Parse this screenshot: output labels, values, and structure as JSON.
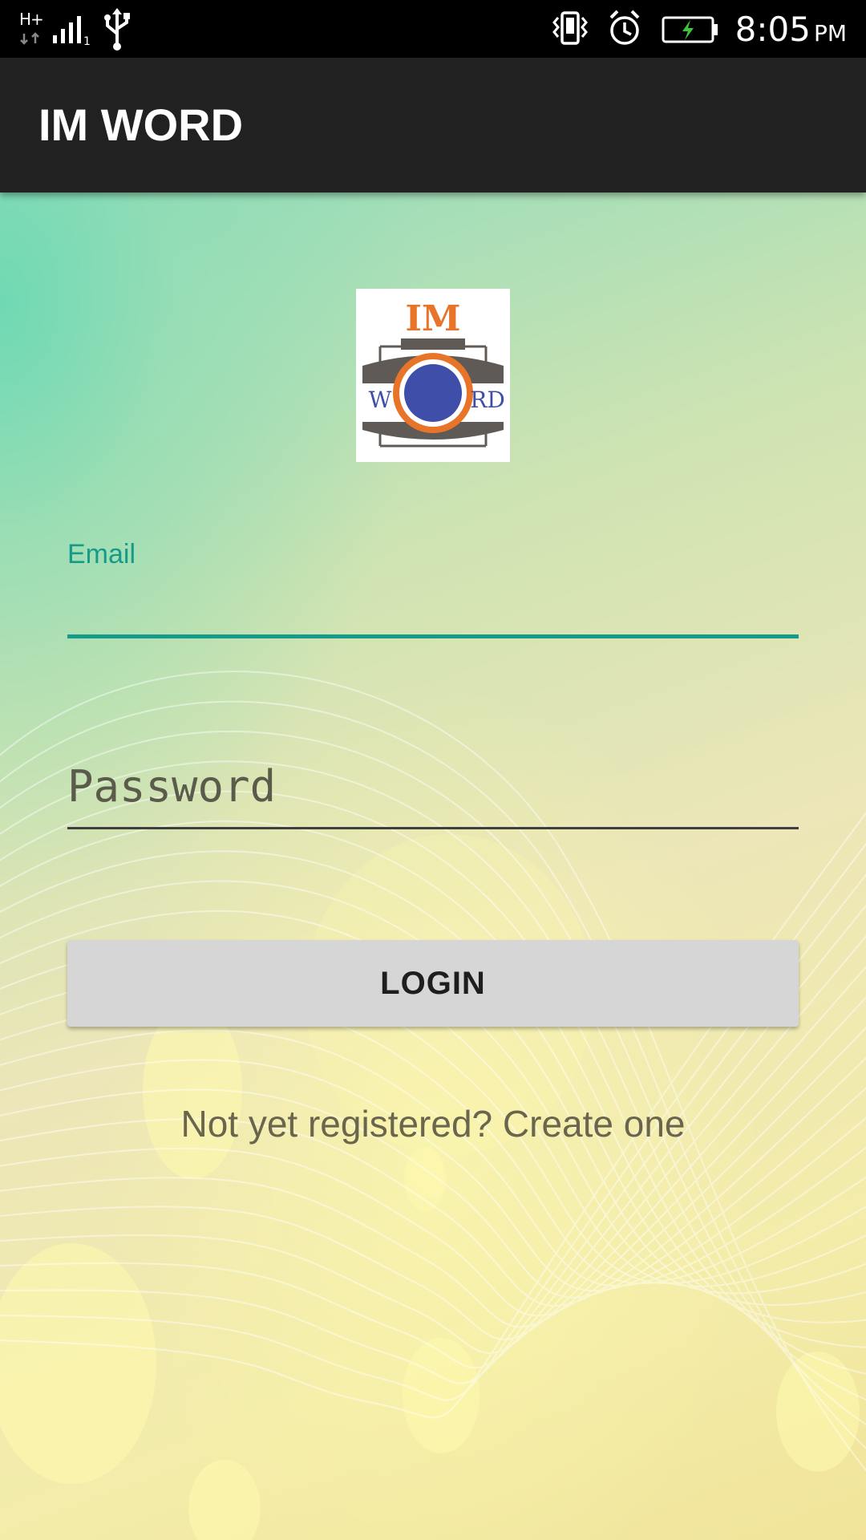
{
  "status_bar": {
    "network_type": "H+",
    "time": "8:05",
    "ampm": "PM",
    "icons": [
      "network-type-icon",
      "signal-icon",
      "usb-icon",
      "vibrate-icon",
      "alarm-icon",
      "battery-charging-icon"
    ]
  },
  "app_bar": {
    "title": "IM WORD"
  },
  "logo": {
    "top_text": "IM",
    "left_letter": "W",
    "right_letters": "RD",
    "colors": {
      "orange": "#e8742a",
      "blue": "#3f4ea8",
      "gray": "#5f5a55"
    }
  },
  "form": {
    "email_label": "Email",
    "email_value": "",
    "password_placeholder": "Password",
    "password_value": "",
    "login_label": "LOGIN",
    "register_text": "Not yet registered? Create one"
  },
  "colors": {
    "accent": "#159b89",
    "app_bar_bg": "#212121",
    "button_bg": "#d6d6d6",
    "link_text": "#6a664e"
  }
}
